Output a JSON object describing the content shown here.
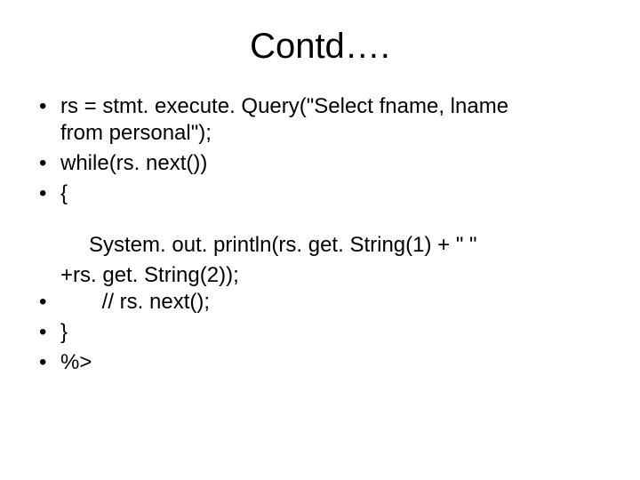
{
  "title": "Contd….",
  "lines": {
    "l1a": " rs = stmt. execute. Query(\"Select fname, lname",
    "l1b": "from personal\");",
    "l2": "while(rs. next())",
    "l3": "{",
    "mid1": "System. out. println(rs. get. String(1) + \" \"",
    "mid2": "+rs. get. String(2));",
    "l4": "       // rs. next();",
    "l5": "}",
    "l6": "%>"
  }
}
